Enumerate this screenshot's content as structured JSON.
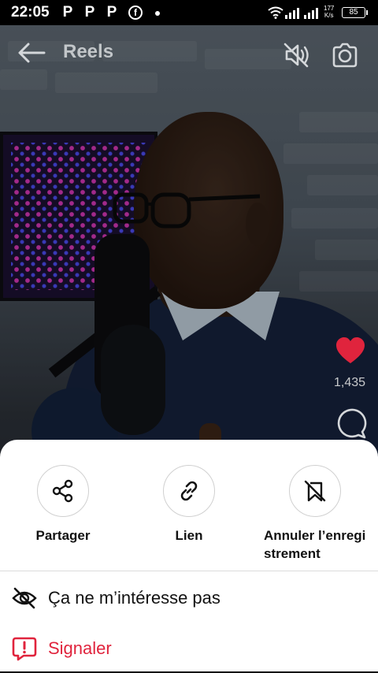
{
  "status_bar": {
    "time": "22:05",
    "notifications": [
      "P",
      "P",
      "P"
    ],
    "net_speed_value": "177",
    "net_speed_unit": "K/s",
    "battery": "85"
  },
  "header": {
    "title": "Reels"
  },
  "reel": {
    "likes": "1,435",
    "like_color": "#e0243d"
  },
  "sheet": {
    "actions": [
      {
        "label": "Partager",
        "icon": "share-icon"
      },
      {
        "label": "Lien",
        "icon": "link-icon"
      },
      {
        "label": "Annuler l’enregistrement",
        "icon": "unsave-icon"
      }
    ],
    "menu": [
      {
        "label": "Ça ne m’intéresse pas",
        "icon": "eye-slash-icon"
      },
      {
        "label": "Signaler",
        "icon": "report-icon",
        "color": "#e0243d"
      }
    ]
  }
}
